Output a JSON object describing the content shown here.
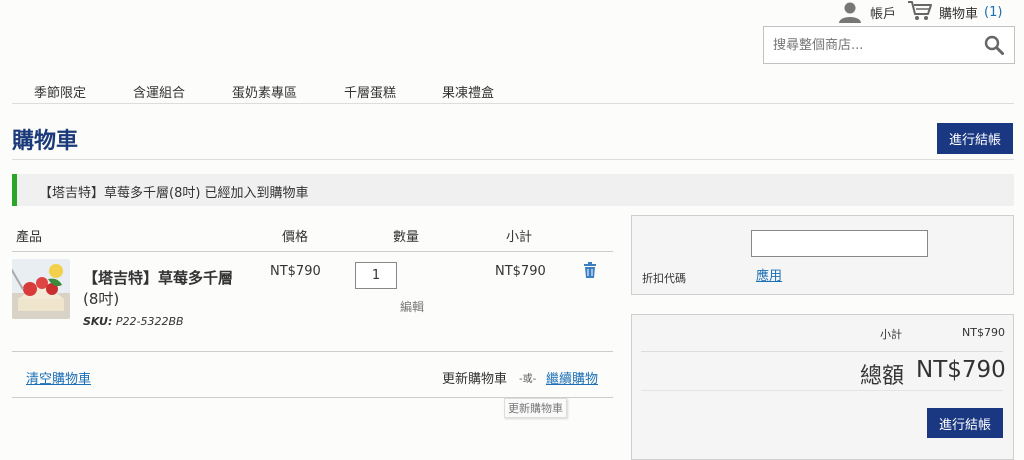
{
  "header": {
    "account_label": "帳戶",
    "cart_label": "購物車",
    "cart_count": "(1)",
    "search_placeholder": "搜尋整個商店..."
  },
  "nav": {
    "items": [
      "季節限定",
      "含運組合",
      "蛋奶素專區",
      "千層蛋糕",
      "果凍禮盒"
    ]
  },
  "page": {
    "title": "購物車",
    "checkout_label": "進行結帳",
    "success_message": "【塔吉特】草莓多千層(8吋) 已經加入到購物車"
  },
  "cart": {
    "headers": {
      "product": "產品",
      "price": "價格",
      "qty": "數量",
      "subtotal": "小計"
    },
    "item": {
      "name": "【塔吉特】草莓多千層",
      "size": "(8吋)",
      "sku_label": "SKU:",
      "sku": "P22-5322BB",
      "price": "NT$790",
      "qty": "1",
      "edit_label": "編輯",
      "subtotal": "NT$790"
    },
    "clear_label": "清空購物車",
    "update_label": "更新購物車",
    "or_label": "-或-",
    "continue_label": "繼續購物",
    "tooltip": "更新購物車"
  },
  "discount": {
    "label": "折扣代碼",
    "apply_label": "應用",
    "value": ""
  },
  "summary": {
    "subtotal_label": "小計",
    "subtotal_value": "NT$790",
    "total_label": "總額",
    "total_value": "NT$790",
    "checkout_label": "進行結帳"
  },
  "colors": {
    "brand_blue": "#1a3882",
    "link_blue": "#1a6fb5",
    "success_green": "#2aa52a"
  },
  "icons": {
    "account": "person-icon",
    "cart": "cart-icon",
    "search": "search-icon",
    "delete": "trash-icon"
  }
}
